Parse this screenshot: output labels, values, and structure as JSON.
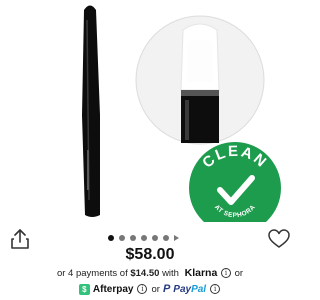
{
  "product": {
    "price": "$58.00"
  },
  "badge": {
    "title": "CLEAN",
    "subtitle": "AT SEPHORA",
    "color": "#1e9c4e"
  },
  "carousel": {
    "dot_count": 6,
    "active_index": 0
  },
  "payments": {
    "prefix": "or 4 payments of",
    "amount": "$14.50",
    "with": "with",
    "klarna": "Klarna",
    "or1": "or",
    "afterpay": "Afterpay",
    "or2": "or",
    "paypal_pay": "Pay",
    "paypal_pal": "Pal"
  },
  "icons": {
    "share": "share-icon",
    "wishlist": "heart-icon",
    "info": "info-icon"
  }
}
